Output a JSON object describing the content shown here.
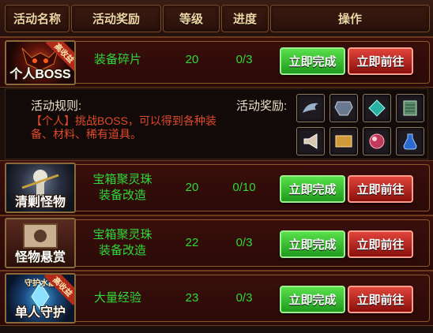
{
  "header": {
    "col_name": "活动名称",
    "col_reward": "活动奖励",
    "col_level": "等级",
    "col_progress": "进度",
    "col_action": "操作"
  },
  "tags": {
    "high_reward": "高收益"
  },
  "buttons": {
    "complete": "立即完成",
    "go": "立即前往"
  },
  "rows": [
    {
      "name": "个人BOSS",
      "reward": "装备碎片",
      "level": "20",
      "progress": "0/3"
    },
    {
      "name": "清剿怪物",
      "reward_line1": "宝箱聚灵珠",
      "reward_line2": "装备改造",
      "level": "20",
      "progress": "0/10"
    },
    {
      "name": "怪物悬赏",
      "reward_line1": "宝箱聚灵珠",
      "reward_line2": "装备改造",
      "level": "22",
      "progress": "0/3"
    },
    {
      "name": "单人守护",
      "sublabel": "守护水晶",
      "reward": "大量经验",
      "level": "23",
      "progress": "0/3"
    }
  ],
  "rules": {
    "title": "活动规则:",
    "text": "【个人】挑战BOSS，可以得到各种装备、材料、稀有道具。",
    "reward_title": "活动奖励:",
    "reward_icons": [
      "wing-icon",
      "armor-icon",
      "gem-icon",
      "scroll-box-icon",
      "horn-icon",
      "map-scroll-icon",
      "orb-icon",
      "potion-icon"
    ]
  }
}
